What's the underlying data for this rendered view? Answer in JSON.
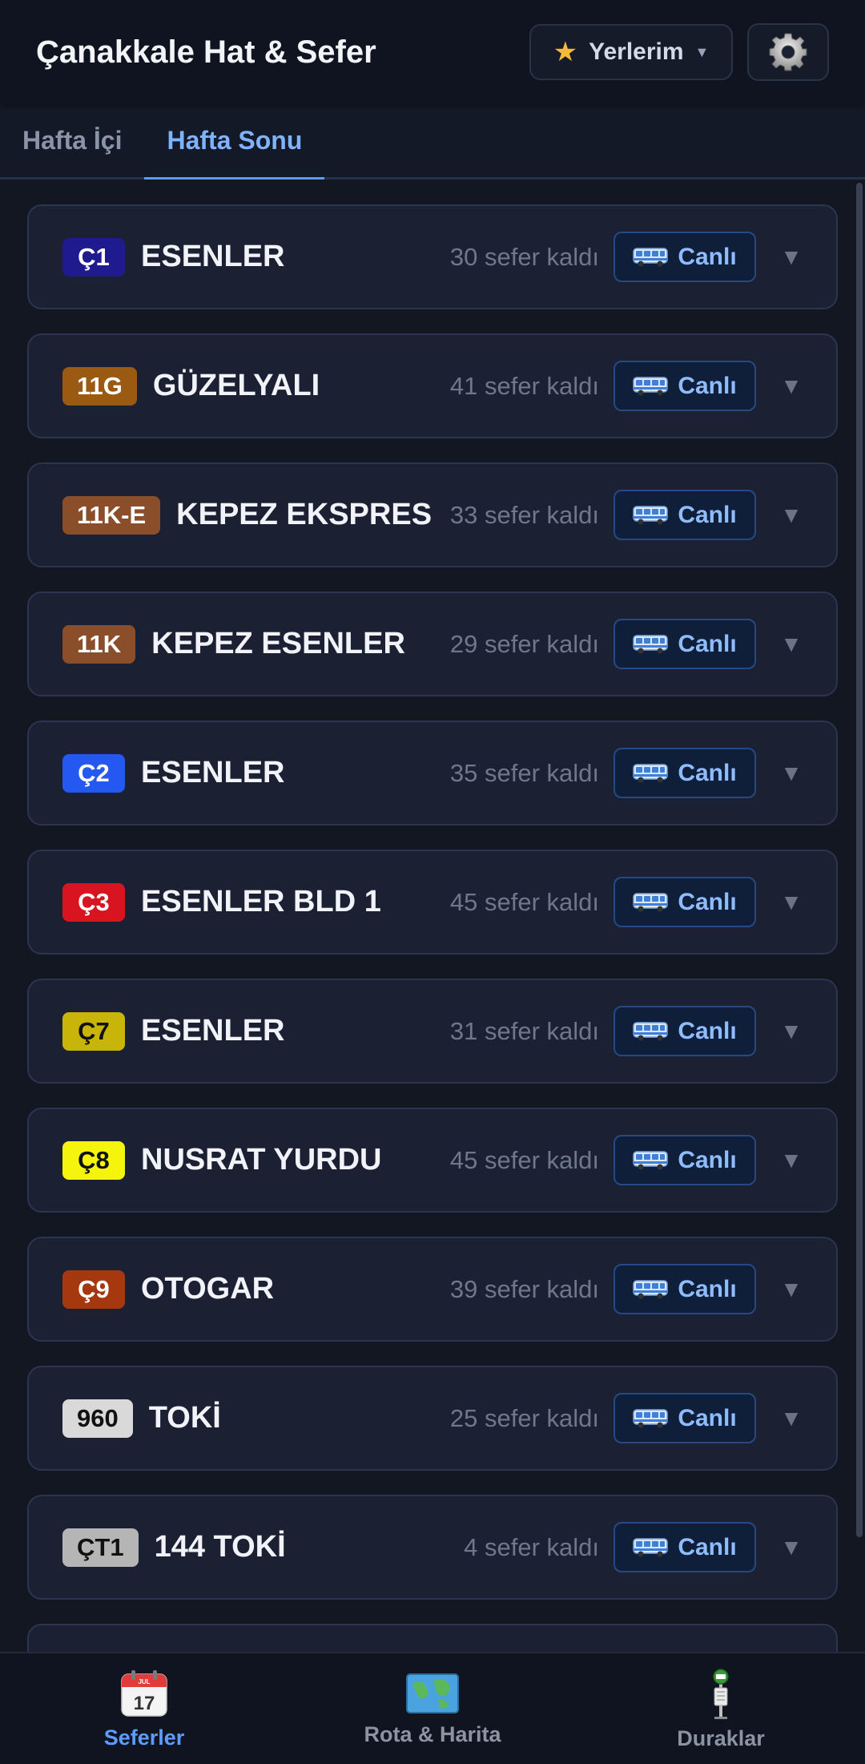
{
  "header": {
    "title": "Çanakkale Hat & Sefer",
    "places_label": "Yerlerim",
    "places_icon": "star-icon",
    "settings_icon": "gear-icon"
  },
  "tabs": [
    {
      "label": "Hafta İçi",
      "active": false
    },
    {
      "label": "Hafta Sonu",
      "active": true
    }
  ],
  "routes": [
    {
      "code": "Ç1",
      "name": "ESENLER",
      "remaining": "30 sefer kaldı",
      "live": "Canlı",
      "color": "#1f1b8f",
      "text_color": "#ffffff"
    },
    {
      "code": "11G",
      "name": "GÜZELYALI",
      "remaining": "41 sefer kaldı",
      "live": "Canlı",
      "color": "#9a5a12",
      "text_color": "#ffffff"
    },
    {
      "code": "11K-E",
      "name": "KEPEZ EKSPRES",
      "remaining": "33 sefer kaldı",
      "live": "Canlı",
      "color": "#8a4e2a",
      "text_color": "#ffffff"
    },
    {
      "code": "11K",
      "name": "KEPEZ ESENLER",
      "remaining": "29 sefer kaldı",
      "live": "Canlı",
      "color": "#8a4e2a",
      "text_color": "#ffffff"
    },
    {
      "code": "Ç2",
      "name": "ESENLER",
      "remaining": "35 sefer kaldı",
      "live": "Canlı",
      "color": "#2458f0",
      "text_color": "#ffffff"
    },
    {
      "code": "Ç3",
      "name": "ESENLER BLD 1",
      "remaining": "45 sefer kaldı",
      "live": "Canlı",
      "color": "#d7141f",
      "text_color": "#ffffff"
    },
    {
      "code": "Ç7",
      "name": "ESENLER",
      "remaining": "31 sefer kaldı",
      "live": "Canlı",
      "color": "#c9b40a",
      "text_color": "#111111"
    },
    {
      "code": "Ç8",
      "name": "NUSRAT YURDU",
      "remaining": "45 sefer kaldı",
      "live": "Canlı",
      "color": "#f4f40c",
      "text_color": "#111111"
    },
    {
      "code": "Ç9",
      "name": "OTOGAR",
      "remaining": "39 sefer kaldı",
      "live": "Canlı",
      "color": "#a5380e",
      "text_color": "#ffffff"
    },
    {
      "code": "960",
      "name": "TOKİ",
      "remaining": "25 sefer kaldı",
      "live": "Canlı",
      "color": "#d9d9d9",
      "text_color": "#111111"
    },
    {
      "code": "ÇT1",
      "name": "144 TOKİ",
      "remaining": "4 sefer kaldı",
      "live": "Canlı",
      "color": "#b5b5b5",
      "text_color": "#111111"
    },
    {
      "code": "",
      "name": "",
      "remaining": "",
      "live": "",
      "color": "#1b2133",
      "text_color": "#ffffff"
    }
  ],
  "bottom_nav": [
    {
      "label": "Seferler",
      "icon": "calendar-icon",
      "active": true,
      "icon_text": "17",
      "icon_month": "JUL"
    },
    {
      "label": "Rota & Harita",
      "icon": "map-icon",
      "active": false
    },
    {
      "label": "Duraklar",
      "icon": "bus-stop-icon",
      "active": false
    }
  ]
}
